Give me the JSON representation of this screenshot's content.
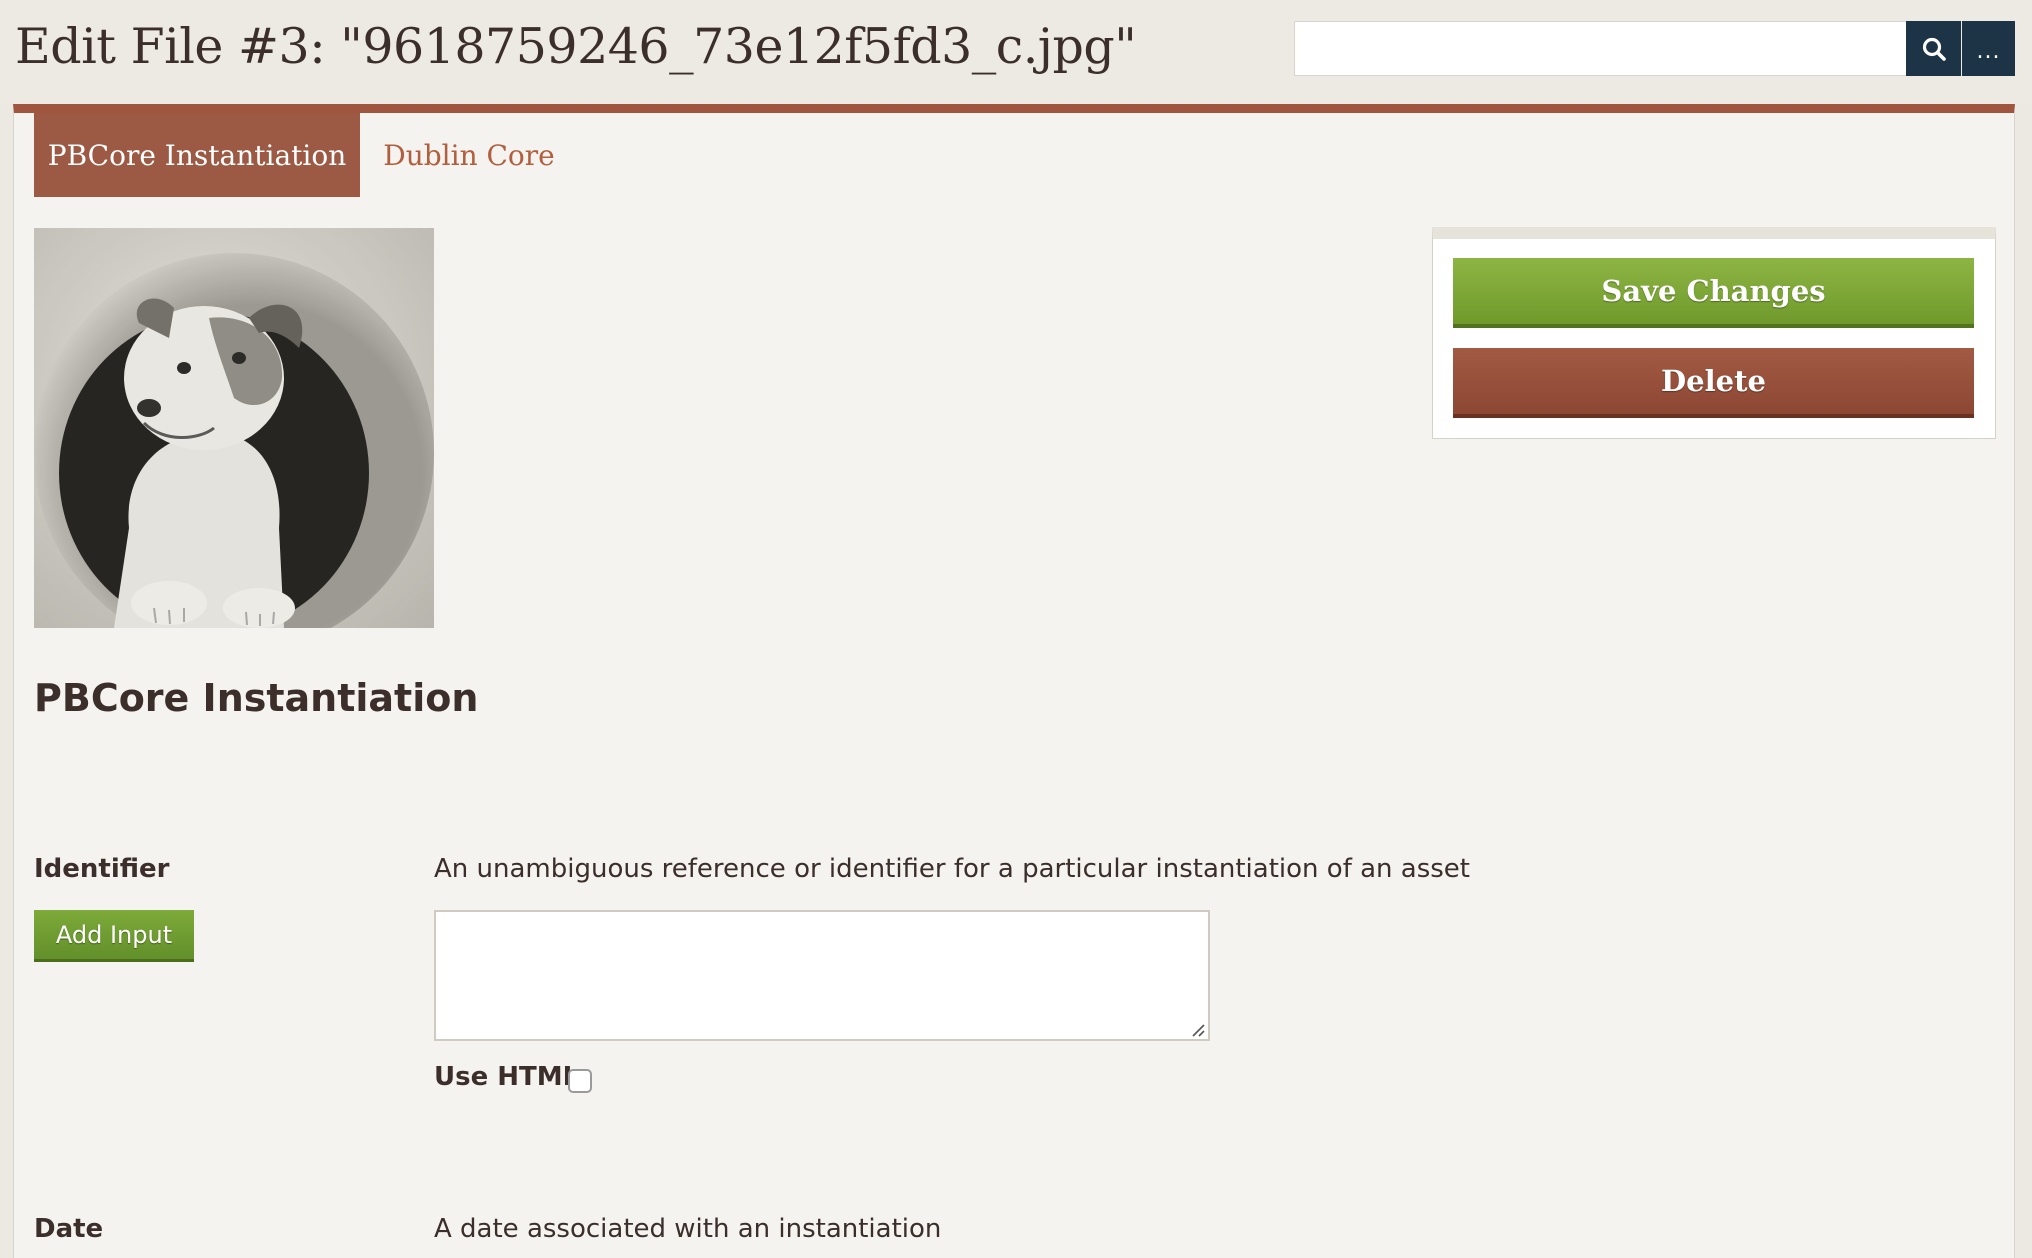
{
  "header": {
    "title": "Edit File #3: \"9618759246_73e12f5fd3_c.jpg\"",
    "search": {
      "value": "",
      "placeholder": ""
    },
    "search_icon": "search-icon",
    "more_label": "..."
  },
  "tabs": [
    {
      "label": "PBCore Instantiation",
      "active": true
    },
    {
      "label": "Dublin Core",
      "active": false
    }
  ],
  "thumbnail": {
    "alt": "Photo of a puppy looking out of a round hole"
  },
  "actions": {
    "save_label": "Save Changes",
    "delete_label": "Delete"
  },
  "section": {
    "title": "PBCore Instantiation"
  },
  "fields": [
    {
      "label": "Identifier",
      "description": "An unambiguous reference or identifier for a particular instantiation of an asset",
      "add_input_label": "Add Input",
      "value": "",
      "use_html_label": "Use HTML",
      "use_html_checked": false
    },
    {
      "label": "Date",
      "description": "A date associated with an instantiation"
    }
  ],
  "colors": {
    "accent": "#a0553f",
    "save": "#7aa636",
    "delete": "#94503a",
    "search_button": "#1d3447",
    "link": "#b05f3f"
  }
}
